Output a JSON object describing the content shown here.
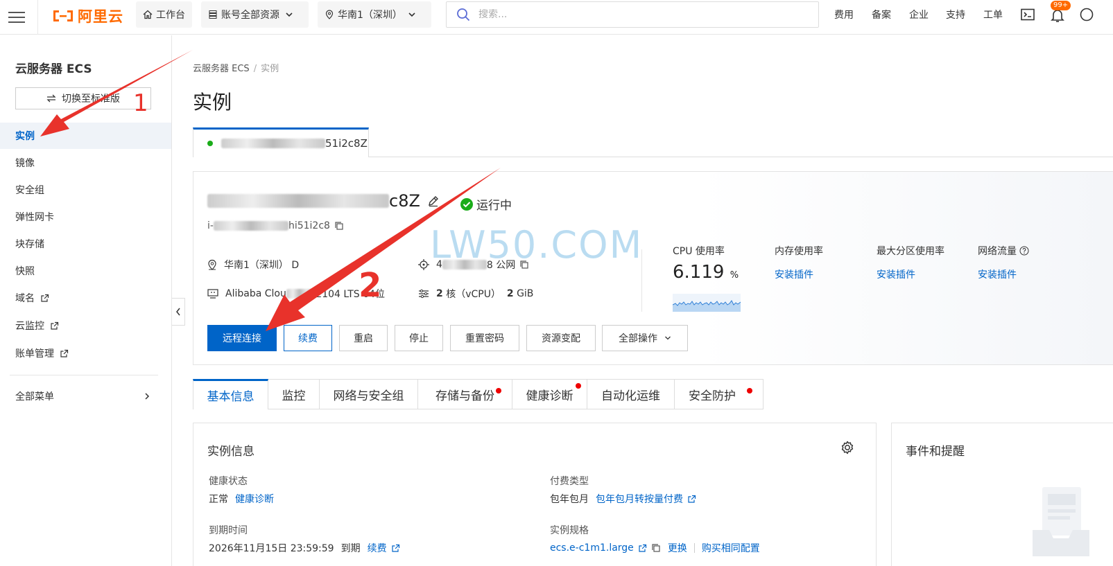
{
  "topbar": {
    "logo_text": "阿里云",
    "workbench": "工作台",
    "resources": "账号全部资源",
    "region": "华南1（深圳）",
    "search_placeholder": "搜索...",
    "links": [
      "费用",
      "备案",
      "企业",
      "支持",
      "工单"
    ],
    "badge": "99+"
  },
  "sidebar": {
    "title": "云服务器 ECS",
    "switch_label": "切换至标准版",
    "items": [
      {
        "label": "实例"
      },
      {
        "label": "镜像"
      },
      {
        "label": "安全组"
      },
      {
        "label": "弹性网卡"
      },
      {
        "label": "块存储"
      },
      {
        "label": "快照"
      },
      {
        "label": "域名"
      },
      {
        "label": "云监控"
      },
      {
        "label": "账单管理"
      }
    ],
    "all_menu": "全部菜单"
  },
  "breadcrumb": {
    "root": "云服务器 ECS",
    "current": "实例"
  },
  "page_title": "实例",
  "instance_tab": {
    "suffix": "51i2c8Z"
  },
  "instance": {
    "name_suffix": "c8Z",
    "status": "运行中",
    "id_prefix": "i-",
    "id_suffix": "hi51i2c8",
    "zone": "华南1（深圳） D",
    "ip_prefix": "4",
    "ip_suffix": "8 公网",
    "os_prefix": "Alibaba Clou",
    "os_suffix": ".2104 LTS 64位",
    "cpu": "2",
    "cpu_unit": "核（vCPU）",
    "mem": "2",
    "mem_unit": "GiB"
  },
  "metrics": {
    "cpu_label": "CPU 使用率",
    "cpu_value": "6.119",
    "cpu_unit": "%",
    "mem_label": "内存使用率",
    "disk_label": "最大分区使用率",
    "net_label": "网络流量",
    "install": "安装插件"
  },
  "buttons": {
    "remote": "远程连接",
    "renew": "续费",
    "restart": "重启",
    "stop": "停止",
    "reset_pwd": "重置密码",
    "resize": "资源变配",
    "all_ops": "全部操作"
  },
  "watermark": "LW50.COM",
  "tabs": [
    "基本信息",
    "监控",
    "网络与安全组",
    "存储与备份",
    "健康诊断",
    "自动化运维",
    "安全防护"
  ],
  "detail": {
    "title": "实例信息",
    "health_label": "健康状态",
    "health_value": "正常",
    "health_link": "健康诊断",
    "billing_label": "付费类型",
    "billing_value": "包年包月",
    "billing_link": "包年包月转按量付费",
    "expire_label": "到期时间",
    "expire_value": "2026年11月15日 23:59:59",
    "expire_suffix": "到期",
    "expire_link": "续费",
    "spec_label": "实例规格",
    "spec_value": "ecs.e-c1m1.large",
    "spec_change": "更换",
    "spec_buy": "购买相同配置"
  },
  "events": {
    "title": "事件和提醒"
  },
  "annotations": {
    "one": "1",
    "two": "2"
  },
  "colors": {
    "accent": "#0064c8",
    "brand": "#ff6a00",
    "arrow": "#e8322b",
    "running": "#1aac19"
  }
}
